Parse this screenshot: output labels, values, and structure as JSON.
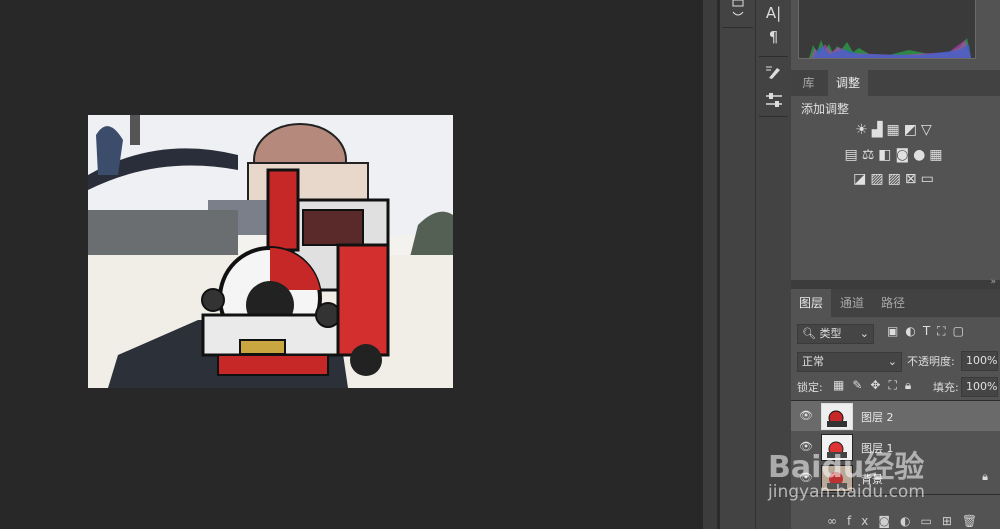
{
  "adjustments_panel": {
    "tab_library": "库",
    "tab_adjustments": "调整",
    "add_adjustment_label": "添加调整"
  },
  "layers_panel": {
    "tab_layers": "图层",
    "tab_channels": "通道",
    "tab_paths": "路径",
    "filter_kind": "类型",
    "blend_mode": "正常",
    "opacity_label": "不透明度:",
    "opacity_value": "100%",
    "lock_label": "锁定:",
    "fill_label": "填充:",
    "fill_value": "100%",
    "layers": [
      {
        "name": "图层 2",
        "selected": true
      },
      {
        "name": "图层 1",
        "selected": false
      },
      {
        "name": "背景",
        "selected": false,
        "locked": true
      }
    ]
  },
  "watermark": {
    "brand": "Baidu经验",
    "url": "jingyan.baidu.com"
  },
  "colors": {
    "canvas_bg": "#282828",
    "panel_bg": "#535353",
    "tab_bar": "#424242",
    "selected_layer": "#6a6a6a"
  }
}
